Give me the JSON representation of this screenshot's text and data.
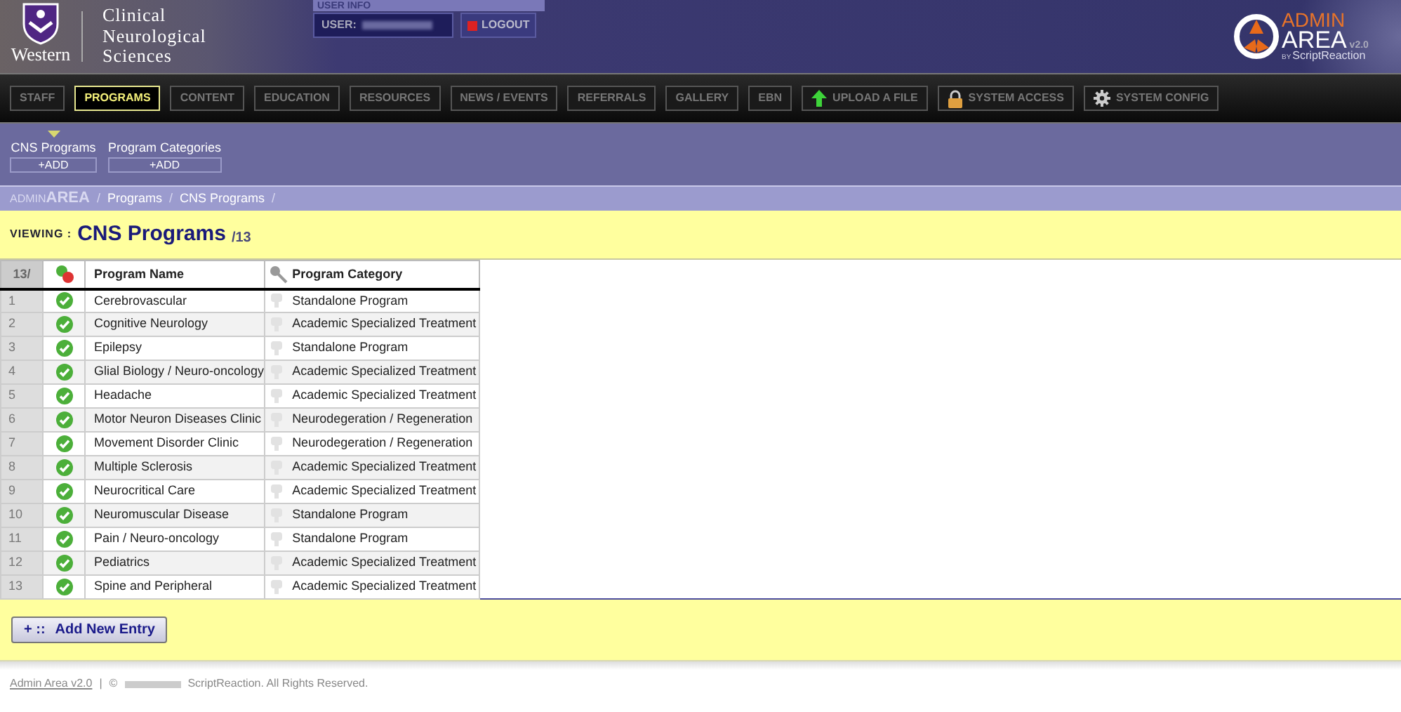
{
  "header": {
    "brand": "Western",
    "department": [
      "Clinical",
      "Neurological",
      "Sciences"
    ],
    "user_info_label": "USER INFO",
    "user_label": "USER:",
    "logout": "LOGOUT",
    "product": {
      "word1": "ADMIN",
      "word2": "AREA",
      "version": "v2.0",
      "by": "BY",
      "maker": "ScriptReaction"
    }
  },
  "nav": [
    {
      "label": "STAFF",
      "kind": "section",
      "selected": false
    },
    {
      "label": "PROGRAMS",
      "kind": "section",
      "selected": true
    },
    {
      "label": "CONTENT",
      "kind": "section",
      "selected": false
    },
    {
      "label": "EDUCATION",
      "kind": "section",
      "selected": false
    },
    {
      "label": "RESOURCES",
      "kind": "section",
      "selected": false
    },
    {
      "label": "NEWS / EVENTS",
      "kind": "section",
      "selected": false
    },
    {
      "label": "REFERRALS",
      "kind": "section",
      "selected": false
    },
    {
      "label": "GALLERY",
      "kind": "section",
      "selected": false
    },
    {
      "label": "EBN",
      "kind": "section",
      "selected": false
    },
    {
      "label": "UPLOAD A FILE",
      "kind": "upload",
      "selected": false
    },
    {
      "label": "SYSTEM ACCESS",
      "kind": "access",
      "selected": false
    },
    {
      "label": "SYSTEM CONFIG",
      "kind": "config",
      "selected": false
    }
  ],
  "subnav": [
    {
      "label": "CNS Programs",
      "add": "+ADD",
      "selected": true
    },
    {
      "label": "Program Categories",
      "add": "+ADD",
      "selected": false
    }
  ],
  "breadcrumb_separator": "/",
  "breadcrumb": [
    {
      "label": "ADMIN",
      "label2": "AREA",
      "kind": "root"
    },
    {
      "label": "Programs",
      "kind": "link"
    },
    {
      "label": "CNS Programs",
      "kind": "link"
    }
  ],
  "viewing": {
    "prefix": "VIEWING :",
    "title": "CNS Programs",
    "count": "/13"
  },
  "table": {
    "columns": [
      "13/",
      "Program Name",
      "Program Category"
    ],
    "rows": [
      {
        "number": "1",
        "active": true,
        "name": "Cerebrovascular",
        "category": "Standalone Program"
      },
      {
        "number": "2",
        "active": true,
        "name": "Cognitive Neurology",
        "category": "Academic Specialized Treatment"
      },
      {
        "number": "3",
        "active": true,
        "name": "Epilepsy",
        "category": "Standalone Program"
      },
      {
        "number": "4",
        "active": true,
        "name": "Glial Biology / Neuro-oncology",
        "category": "Academic Specialized Treatment"
      },
      {
        "number": "5",
        "active": true,
        "name": "Headache",
        "category": "Academic Specialized Treatment"
      },
      {
        "number": "6",
        "active": true,
        "name": "Motor Neuron Diseases Clinic",
        "category": "Neurodegeration / Regeneration"
      },
      {
        "number": "7",
        "active": true,
        "name": "Movement Disorder Clinic",
        "category": "Neurodegeration / Regeneration"
      },
      {
        "number": "8",
        "active": true,
        "name": "Multiple Sclerosis",
        "category": "Academic Specialized Treatment"
      },
      {
        "number": "9",
        "active": true,
        "name": "Neurocritical Care",
        "category": "Academic Specialized Treatment"
      },
      {
        "number": "10",
        "active": true,
        "name": "Neuromuscular Disease",
        "category": "Standalone Program"
      },
      {
        "number": "11",
        "active": true,
        "name": "Pain / Neuro-oncology",
        "category": "Standalone Program"
      },
      {
        "number": "12",
        "active": true,
        "name": "Pediatrics",
        "category": "Academic Specialized Treatment"
      },
      {
        "number": "13",
        "active": true,
        "name": "Spine and Peripheral",
        "category": "Academic Specialized Treatment"
      }
    ]
  },
  "add_button": {
    "prefix": "+ ::",
    "label": "Add New Entry"
  },
  "footer": {
    "link": "Admin Area v2.0",
    "separator": "|",
    "copyright": "©",
    "rights": "ScriptReaction. All Rights Reserved."
  }
}
